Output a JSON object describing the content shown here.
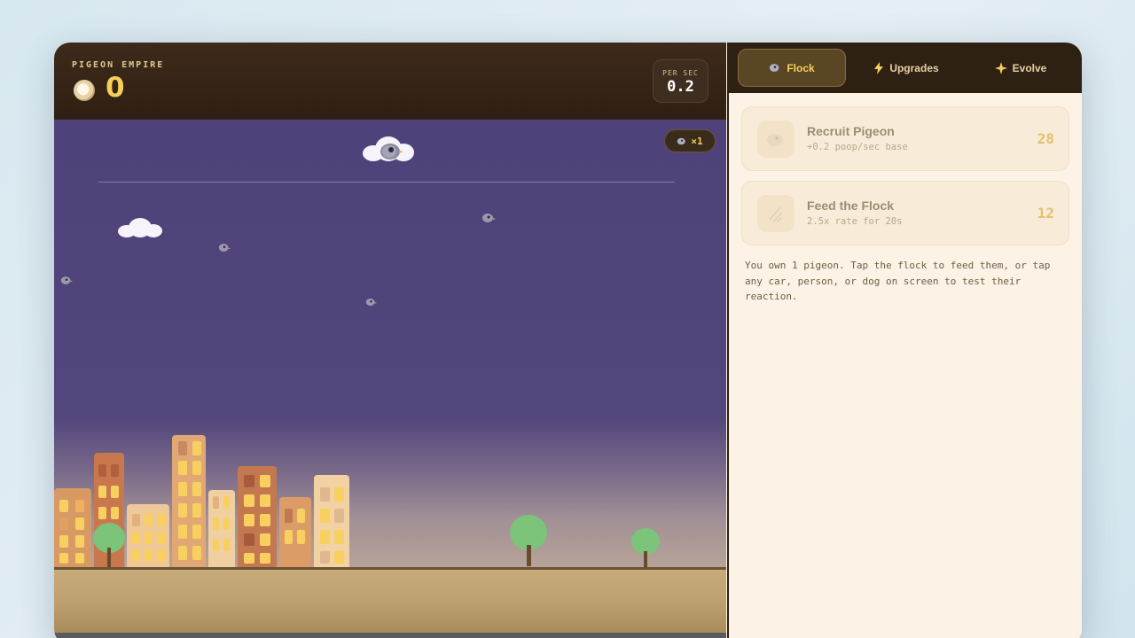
{
  "hud": {
    "title": "PIGEON EMPIRE",
    "poop_count": "0",
    "rate_label": "PER SEC",
    "rate_value": "0.2",
    "icon": "poop-icon"
  },
  "scene": {
    "flock_badge": "×1",
    "flock_icon": "pigeon-icon"
  },
  "tabs": [
    {
      "label": "Flock",
      "icon": "pigeon-icon",
      "active": true
    },
    {
      "label": "Upgrades",
      "icon": "lightning-icon",
      "active": false
    },
    {
      "label": "Evolve",
      "icon": "sparkle-icon",
      "active": false
    }
  ],
  "cards": [
    {
      "title": "Recruit Pigeon",
      "subtitle": "+0.2 poop/sec base",
      "cost": "28",
      "icon": "pigeon-icon"
    },
    {
      "title": "Feed the Flock",
      "subtitle": "2.5x rate for 20s",
      "cost": "12",
      "icon": "seed-icon"
    }
  ],
  "info_text": "You own 1 pigeon. Tap the flock to feed them, or tap any car, person, or dog on screen to test their reaction.",
  "colors": {
    "accent": "#f6cf5a",
    "hud_bg": "#2f2013",
    "panel_bg": "#fcf3e6",
    "sky": "#52467c"
  }
}
